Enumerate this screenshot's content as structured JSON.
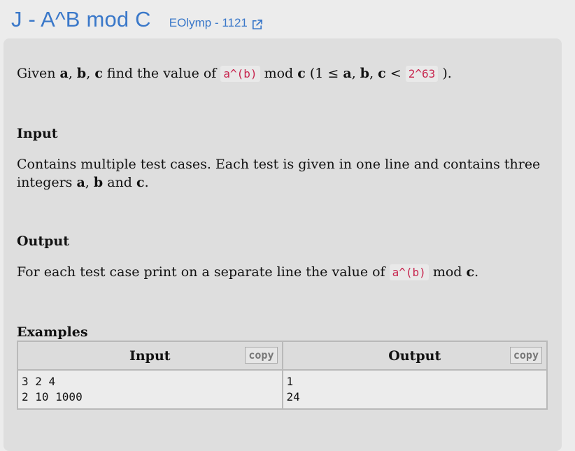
{
  "header": {
    "title": "J - A^B mod C",
    "source_label": "EOlymp - 1121",
    "source_icon": "external-link-icon",
    "accent_color": "#3a78c9"
  },
  "statement": {
    "given": {
      "t1": "Given ",
      "a": "a",
      "sep1": ", ",
      "b": "b",
      "sep2": ", ",
      "c": "c",
      "t2": " find the value of ",
      "expr": "a^(b)",
      "t3": " mod ",
      "c2": "c",
      "t4": " (1 ≤ ",
      "a2": "a",
      "sep3": ", ",
      "b2": "b",
      "sep4": ", ",
      "c3": "c",
      "t5": " < ",
      "limit": "2^63",
      "t6": " )."
    }
  },
  "input_section": {
    "heading": "Input",
    "t1": "Contains multiple test cases. Each test is given in one line and contains three integers ",
    "a": "a",
    "sep1": ", ",
    "b": "b",
    "t2": " and ",
    "c": "c",
    "t3": "."
  },
  "output_section": {
    "heading": "Output",
    "t1": "For each test case print on a separate line the value of ",
    "expr": "a^(b)",
    "t2": " mod ",
    "c": "c",
    "t3": "."
  },
  "examples": {
    "heading": "Examples",
    "input_header": "Input",
    "output_header": "Output",
    "copy_label": "copy",
    "input_text": "3 2 4\n2 10 1000",
    "output_text": "1\n24"
  }
}
